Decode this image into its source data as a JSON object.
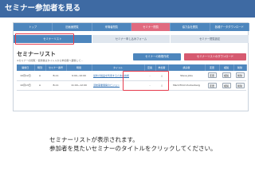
{
  "header": {
    "title": "セミナー参加者を見る"
  },
  "top_nav": {
    "items": [
      {
        "label": "トップ"
      },
      {
        "label": "旧画面閲覧"
      },
      {
        "label": "来場者閲覧"
      },
      {
        "label": "セミナー閲覧"
      },
      {
        "label": "協力会社閲覧"
      },
      {
        "label": "各種データダウンロード"
      }
    ],
    "active_index": 3
  },
  "sub_tabs": [
    {
      "label": "セミナーリスト"
    },
    {
      "label": "セミナー申し込みフォーム"
    },
    {
      "label": "セミナー閲覧設定"
    }
  ],
  "page": {
    "title": "セミナーリスト",
    "note": "※セミナーの閲覧・使用後はタイトルから参加者へ遷移して…"
  },
  "buttons": {
    "new_seminar": "セミナーの新規作成",
    "download_list": "セミナーリストのダウンロード"
  },
  "table": {
    "columns": [
      "開催日",
      "時刻",
      "セミナー番号",
      "時間",
      "タイトル",
      "定員",
      "参加者",
      "講演者",
      "変更",
      "複製",
      "削除"
    ],
    "rows": [
      {
        "date": "10月12日",
        "slot": "A",
        "number": "B-11",
        "time": "9:00~10:00",
        "title": "最新の製品を利用するための技術",
        "capacity": "-",
        "attendees": "△",
        "speaker": "Steve Jobs",
        "edit": "変更",
        "copy": "複製",
        "delete": "削除"
      },
      {
        "date": "10月13日",
        "slot": "A",
        "number": "B-11",
        "time": "11:00~12:00",
        "title": "活動事業展開のビジョン",
        "capacity": "-",
        "attendees": "△",
        "speaker": "Mark Elliot Zuckerberg",
        "edit": "変更",
        "copy": "複製",
        "delete": "削除"
      }
    ]
  },
  "caption": {
    "line1": "セミナーリストが表示されます。",
    "line2": "参加者を見たいセミナーのタイトルをクリックしてください。"
  },
  "colors": {
    "header_bg": "#3e6aa3",
    "nav_bg": "#4d86bd",
    "nav_active": "#e06a7f",
    "download_button": "#d65a70",
    "highlight": "#e63b4d"
  }
}
